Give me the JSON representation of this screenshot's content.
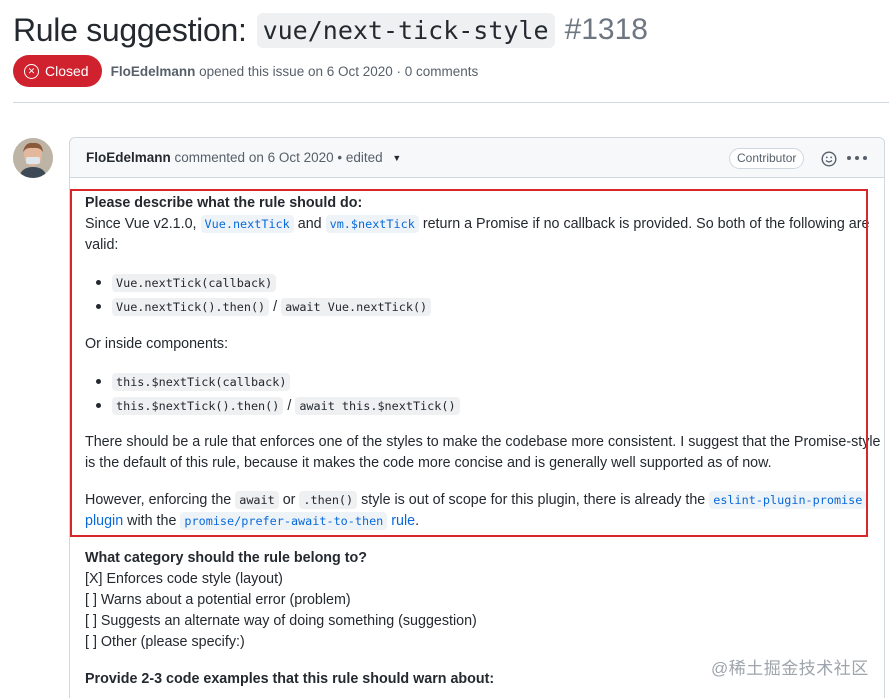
{
  "issue": {
    "title_prefix": "Rule suggestion:",
    "title_code": "vue/next-tick-style",
    "number": "#1318",
    "state": "Closed",
    "author": "FloEdelmann",
    "opened_text": "opened this issue on 6 Oct 2020 · 0 comments"
  },
  "comment": {
    "author": "FloEdelmann",
    "meta": "commented on 6 Oct 2020 • edited",
    "badge": "Contributor",
    "icons": {
      "reaction": "smiley-icon",
      "menu": "kebab-menu-icon",
      "edited": "caret-down-icon",
      "state": "x-circle-icon"
    }
  },
  "body": {
    "heading1": "Please describe what the rule should do:",
    "p1_a": "Since Vue v2.1.0,",
    "p1_code1": "Vue.nextTick",
    "p1_b": "and",
    "p1_code2": "vm.$nextTick",
    "p1_c": "return a Promise if no callback is provided. So both of the following are",
    "p1_d": "valid:",
    "list1": [
      {
        "code1": "Vue.nextTick(callback)"
      },
      {
        "code1": "Vue.nextTick().then()",
        "sep": "/",
        "code2": "await Vue.nextTick()"
      }
    ],
    "p2": "Or inside components:",
    "list2": [
      {
        "code1": "this.$nextTick(callback)"
      },
      {
        "code1": "this.$nextTick().then()",
        "sep": "/",
        "code2": "await this.$nextTick()"
      }
    ],
    "p3_line1": "There should be a rule that enforces one of the styles to make the codebase more consistent. I suggest that the Promise-style",
    "p3_line2": "is the default of this rule, because it makes the code more concise and is generally well supported as of now.",
    "p4_a": "However, enforcing the",
    "p4_code1": "await",
    "p4_b": "or",
    "p4_code2": ".then()",
    "p4_c": "style is out of scope for this plugin, there is already the",
    "p4_link1": "eslint-plugin-promise",
    "p4_link1b": "plugin",
    "p4_d": "with the",
    "p4_link2": "promise/prefer-await-to-then",
    "p4_link2b": "rule",
    "p4_e": ".",
    "heading2": "What category should the rule belong to?",
    "categories": [
      "[X] Enforces code style (layout)",
      "[  ] Warns about a potential error (problem)",
      "[  ] Suggests an alternate way of doing something (suggestion)",
      "[  ] Other (please specify:)"
    ],
    "heading3": "Provide 2-3 code examples that this rule should warn about:"
  },
  "watermark": "@稀土掘金技术社区"
}
